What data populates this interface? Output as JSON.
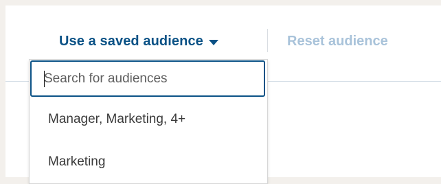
{
  "header": {
    "saved_audience_label": "Use a saved audience",
    "reset_audience_label": "Reset audience"
  },
  "dropdown": {
    "search": {
      "value": "",
      "placeholder": "Search for audiences"
    },
    "items": [
      {
        "label": "Manager, Marketing, 4+"
      },
      {
        "label": "Marketing"
      }
    ]
  },
  "colors": {
    "primary_link": "#0b5286",
    "disabled_link": "#a9c3da",
    "focus_border": "#0b5286"
  },
  "icons": {
    "saved_audience_caret": "caret-down-icon"
  }
}
